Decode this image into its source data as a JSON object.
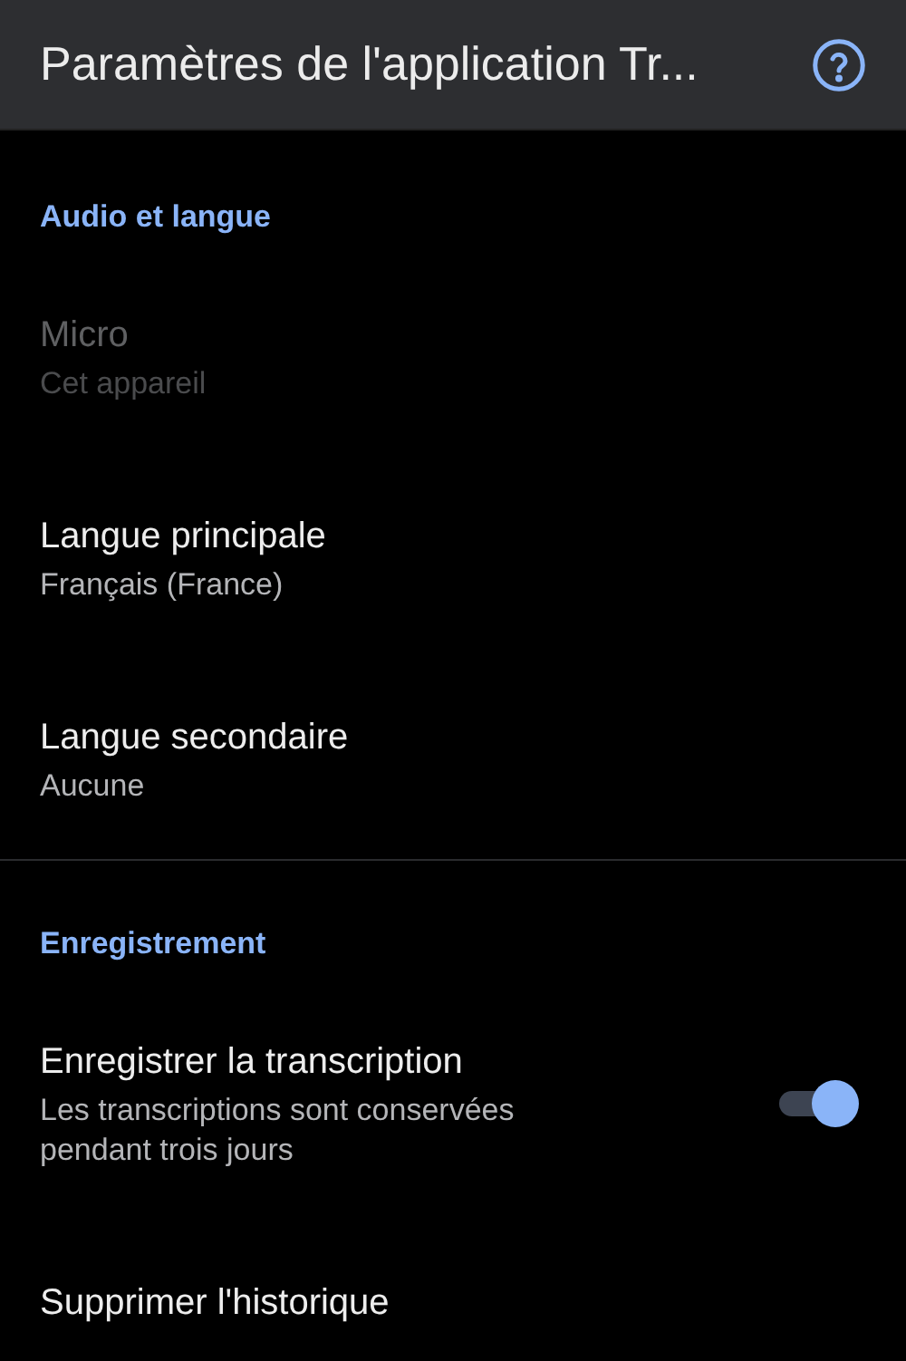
{
  "app_bar": {
    "title": "Paramètres de l'application Tr..."
  },
  "sections": [
    {
      "title": "Audio et langue",
      "items": [
        {
          "kind": "text",
          "title": "Micro",
          "subtitle": "Cet appareil",
          "disabled": true
        },
        {
          "kind": "text",
          "title": "Langue principale",
          "subtitle": "Français (France)",
          "disabled": false
        },
        {
          "kind": "text",
          "title": "Langue secondaire",
          "subtitle": "Aucune",
          "disabled": false
        }
      ]
    },
    {
      "title": "Enregistrement",
      "items": [
        {
          "kind": "switch",
          "title": "Enregistrer la transcription",
          "subtitle": "Les transcriptions sont conservées pendant trois jours",
          "on": true
        },
        {
          "kind": "text",
          "title": "Supprimer l'historique",
          "disabled": false
        }
      ]
    }
  ]
}
